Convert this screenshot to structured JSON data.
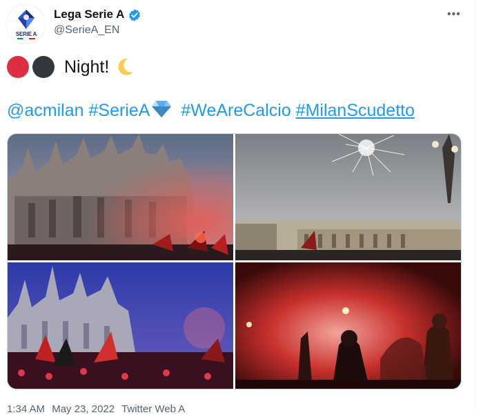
{
  "account": {
    "display_name": "Lega Serie A",
    "handle": "@SerieA_EN",
    "avatar_logo_text": "SERIE A"
  },
  "tweet": {
    "line1_text": "Night!",
    "mention": "@acmilan",
    "hashtag1": "#SerieA",
    "hashtag2": "#WeAreCalcio",
    "hashtag3": "#MilanScudetto"
  },
  "footer": {
    "time": "1:34 AM",
    "date": "May 23, 2022",
    "source": "Twitter Web A"
  },
  "icons": {
    "verified": "verified-badge-icon",
    "more": "more-options-icon",
    "moon": "crescent-moon-icon",
    "gem": "gem-stone-icon"
  },
  "colors": {
    "link": "#1d9bf0",
    "secondary_text": "#536471",
    "red_circle": "#dd2e44",
    "black_circle": "#31373d"
  }
}
